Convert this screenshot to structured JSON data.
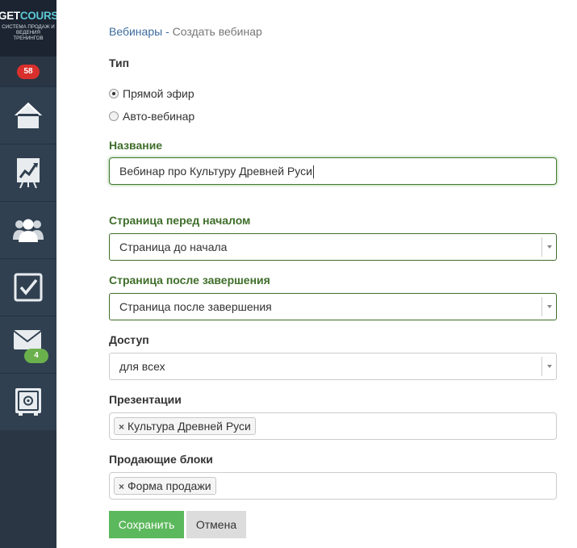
{
  "sidebar": {
    "logo_get": "GET",
    "logo_course": "COURSE",
    "logo_tagline": "СИСТЕМА ПРОДАЖ И ВЕДЕНИЯ ТРЕНИНГОВ",
    "notifications_badge": "58",
    "items": [
      {
        "name": "home",
        "icon": "home-icon"
      },
      {
        "name": "reports",
        "icon": "chart-board-icon"
      },
      {
        "name": "users",
        "icon": "users-icon"
      },
      {
        "name": "tasks",
        "icon": "checkbox-icon"
      },
      {
        "name": "messages",
        "icon": "envelope-icon",
        "badge": "4"
      },
      {
        "name": "safe",
        "icon": "safe-icon"
      }
    ],
    "colors": {
      "bg": "#2d3a48",
      "badge_red": "#d9302c",
      "badge_green": "#6ab04c",
      "accent": "#5bc8d6"
    }
  },
  "breadcrumb": {
    "parent": "Вебинары",
    "separator": "-",
    "current": "Создать вебинар"
  },
  "form": {
    "type_label": "Тип",
    "type_options": [
      {
        "label": "Прямой эфир",
        "checked": true
      },
      {
        "label": "Авто-вебинар",
        "checked": false
      }
    ],
    "name_label": "Название",
    "name_value": "Вебинар про Культуру Древней Руси",
    "before_label": "Страница перед началом",
    "before_value": "Страница до начала",
    "after_label": "Страница после завершения",
    "after_value": "Страница после завершения",
    "access_label": "Доступ",
    "access_value": "для всех",
    "presentations_label": "Презентации",
    "presentations_tags": [
      "Культура Древней Руси"
    ],
    "blocks_label": "Продающие блоки",
    "blocks_tags": [
      "Форма продажи"
    ],
    "tag_remove_glyph": "×",
    "save_label": "Сохранить",
    "cancel_label": "Отмена"
  },
  "colors": {
    "valid_green": "#3f6e2a",
    "save_button": "#5cb85c",
    "link_blue": "#3d6c9e"
  }
}
